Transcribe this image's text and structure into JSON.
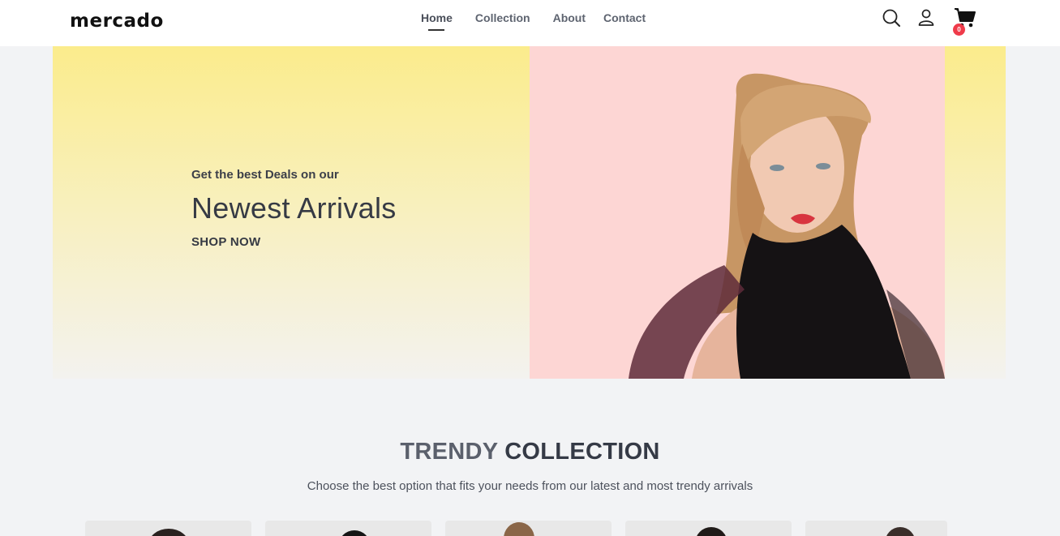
{
  "header": {
    "logo": "mercado",
    "nav": [
      {
        "label": "Home",
        "active": true
      },
      {
        "label": "Collection",
        "active": false
      },
      {
        "label": "About",
        "active": false
      },
      {
        "label": "Contact",
        "active": false
      }
    ],
    "icons": [
      "search-icon",
      "user-icon",
      "cart-icon"
    ],
    "cart_count": "0"
  },
  "hero": {
    "subtitle": "Get the best Deals on our",
    "title": "Newest Arrivals",
    "cta": "SHOP NOW"
  },
  "trendy": {
    "title_light": "TRENDY",
    "title_bold": "COLLECTION",
    "description": "Choose the best option that fits your needs from our latest and most trendy arrivals"
  },
  "colors": {
    "hero_gradient_top": "#fbec8c",
    "hero_photo_bg": "#fdd6d4",
    "badge": "#ef3b4a",
    "page_bg": "#f2f3f5"
  }
}
